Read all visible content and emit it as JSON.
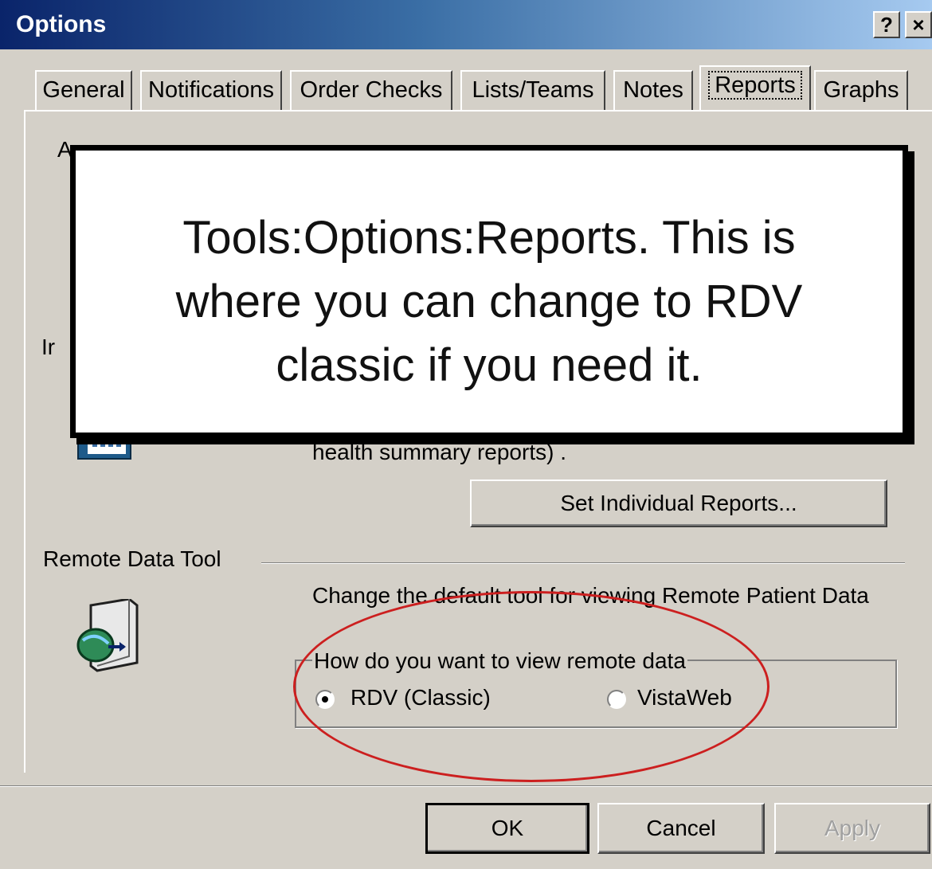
{
  "window": {
    "title": "Options",
    "help_label": "?",
    "close_label": "×"
  },
  "tabs": [
    {
      "label": "General"
    },
    {
      "label": "Notifications"
    },
    {
      "label": "Order Checks"
    },
    {
      "label": "Lists/Teams"
    },
    {
      "label": "Notes"
    },
    {
      "label": "Reports",
      "active": true
    },
    {
      "label": "Graphs"
    }
  ],
  "callout": {
    "line1": "Tools:Options:Reports. This is",
    "line2": "where you can change to RDV",
    "line3": "classic if you need it."
  },
  "partial_labels": {
    "left_top": "A",
    "left_mid": "Ir"
  },
  "reports": {
    "description_tail": "health summary reports) .",
    "set_individual_button": "Set Individual Reports..."
  },
  "remote_data_tool": {
    "section_label": "Remote Data Tool",
    "description": "Change the default tool for viewing Remote Patient Data",
    "group_label": "How do you want to view remote data",
    "options": [
      {
        "label": "RDV (Classic)",
        "selected": true
      },
      {
        "label": "VistaWeb",
        "selected": false
      }
    ]
  },
  "buttons": {
    "ok": "OK",
    "cancel": "Cancel",
    "apply": "Apply"
  },
  "colors": {
    "annotation_ellipse": "#cc1f1f",
    "titlebar": "#0a246a",
    "dialog_face": "#d4d0c8"
  }
}
